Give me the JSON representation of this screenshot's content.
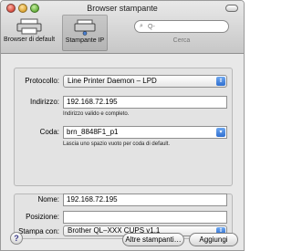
{
  "window": {
    "title": "Browser stampante"
  },
  "toolbar": {
    "default_label": "Browser di default",
    "ip_label": "Stampante IP",
    "search_placeholder": "Q-",
    "search_caption": "Cerca"
  },
  "connection": {
    "protocol_label": "Protocollo:",
    "protocol_value": "Line Printer Daemon – LPD",
    "address_label": "Indirizzo:",
    "address_value": "192.168.72.195",
    "address_hint": "Indirizzo valido e completo.",
    "queue_label": "Coda:",
    "queue_value": "brn_8848F1_p1",
    "queue_hint": "Lascia uno spazio vuoto per coda di default."
  },
  "details": {
    "name_label": "Nome:",
    "name_value": "192.168.72.195",
    "location_label": "Posizione:",
    "location_value": "",
    "print_with_label": "Stampa con:",
    "print_with_value": "Brother QL–XXX    CUPS v1.1"
  },
  "footer": {
    "help_label": "?",
    "more_printers_label": "Altre stampanti…",
    "add_label": "Aggiungi"
  },
  "colors": {
    "popup_accent": "#2f6fd0"
  }
}
